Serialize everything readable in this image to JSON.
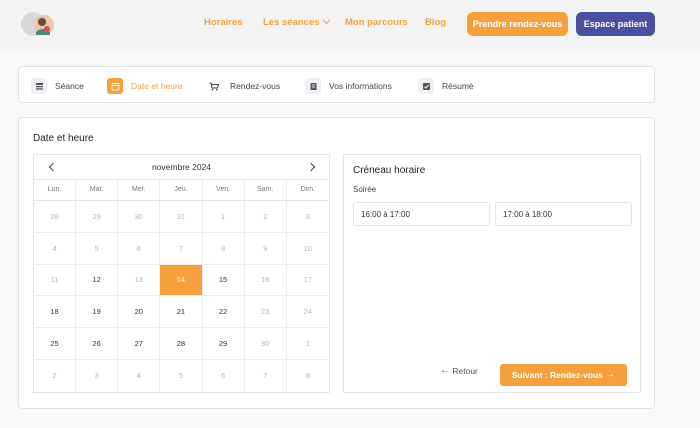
{
  "header": {
    "nav": {
      "horaires": "Horaires",
      "seances": "Les séances",
      "parcours": "Mon parcours",
      "blog": "Blog"
    },
    "cta_rdv": "Prendre rendez-vous",
    "cta_patient": "Espace patient",
    "colors": {
      "orange": "#f5a03c",
      "indigo": "#4b4fa0"
    }
  },
  "steps": [
    {
      "label": "Séance",
      "icon": "list-icon",
      "active": false
    },
    {
      "label": "Date et heure",
      "icon": "calendar-icon",
      "active": true
    },
    {
      "label": "Rendez-vous",
      "icon": "cart-icon",
      "active": false
    },
    {
      "label": "Vos informations",
      "icon": "form-icon",
      "active": false
    },
    {
      "label": "Résumé",
      "icon": "check-icon",
      "active": false
    }
  ],
  "card": {
    "title": "Date et heure"
  },
  "calendar": {
    "month": "novembre 2024",
    "weekdays": [
      "Lun.",
      "Mar.",
      "Mer.",
      "Jeu.",
      "Ven.",
      "Sam.",
      "Dim."
    ],
    "weeks": [
      [
        {
          "d": "28",
          "m": true
        },
        {
          "d": "29",
          "m": true
        },
        {
          "d": "30",
          "m": true
        },
        {
          "d": "31",
          "m": true
        },
        {
          "d": "1",
          "m": true
        },
        {
          "d": "2",
          "m": true
        },
        {
          "d": "3",
          "m": true
        }
      ],
      [
        {
          "d": "4",
          "m": true
        },
        {
          "d": "5",
          "m": true
        },
        {
          "d": "6",
          "m": true
        },
        {
          "d": "7",
          "m": true
        },
        {
          "d": "8",
          "m": true
        },
        {
          "d": "9",
          "m": true
        },
        {
          "d": "10",
          "m": true
        }
      ],
      [
        {
          "d": "11",
          "m": true
        },
        {
          "d": "12",
          "m": false
        },
        {
          "d": "13",
          "m": true
        },
        {
          "d": "14",
          "m": false,
          "s": true
        },
        {
          "d": "15",
          "m": false
        },
        {
          "d": "16",
          "m": true
        },
        {
          "d": "17",
          "m": true
        }
      ],
      [
        {
          "d": "18",
          "m": false
        },
        {
          "d": "19",
          "m": false
        },
        {
          "d": "20",
          "m": false
        },
        {
          "d": "21",
          "m": false
        },
        {
          "d": "22",
          "m": false
        },
        {
          "d": "23",
          "m": true
        },
        {
          "d": "24",
          "m": true
        }
      ],
      [
        {
          "d": "25",
          "m": false
        },
        {
          "d": "26",
          "m": false
        },
        {
          "d": "27",
          "m": false
        },
        {
          "d": "28",
          "m": false
        },
        {
          "d": "29",
          "m": false
        },
        {
          "d": "30",
          "m": true
        },
        {
          "d": "1",
          "m": true
        }
      ],
      [
        {
          "d": "2",
          "m": true
        },
        {
          "d": "3",
          "m": true
        },
        {
          "d": "4",
          "m": true
        },
        {
          "d": "5",
          "m": true
        },
        {
          "d": "6",
          "m": true
        },
        {
          "d": "7",
          "m": true
        },
        {
          "d": "8",
          "m": true
        }
      ]
    ]
  },
  "slots": {
    "title": "Créneau horaire",
    "period": "Soirée",
    "items": [
      "16:00 à 17:00",
      "17:00 à 18:00"
    ],
    "back_label": "Retour",
    "next_label": "Suivant : Rendez-vous"
  }
}
